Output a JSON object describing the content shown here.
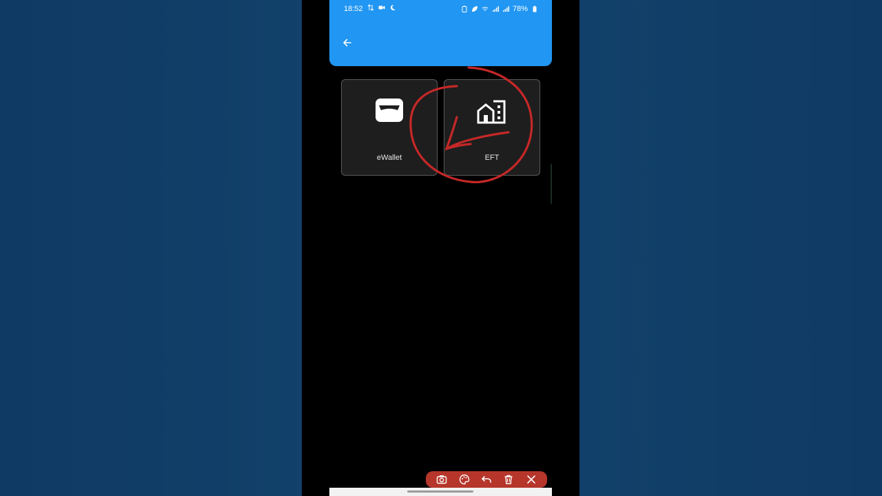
{
  "status_bar": {
    "time": "18:52",
    "battery": "78%"
  },
  "header": {
    "back_icon": "arrow-left-icon",
    "color": "#2196f3"
  },
  "tiles": [
    {
      "label": "eWallet",
      "icon": "wallet-icon"
    },
    {
      "label": "EFT",
      "icon": "bank-building-icon"
    }
  ],
  "annotation": {
    "color": "#c62828",
    "shape": "circle-with-arrow"
  },
  "toolbar": {
    "color": "#b7362c",
    "tools": [
      "camera-icon",
      "palette-icon",
      "undo-icon",
      "trash-icon",
      "close-icon"
    ]
  }
}
